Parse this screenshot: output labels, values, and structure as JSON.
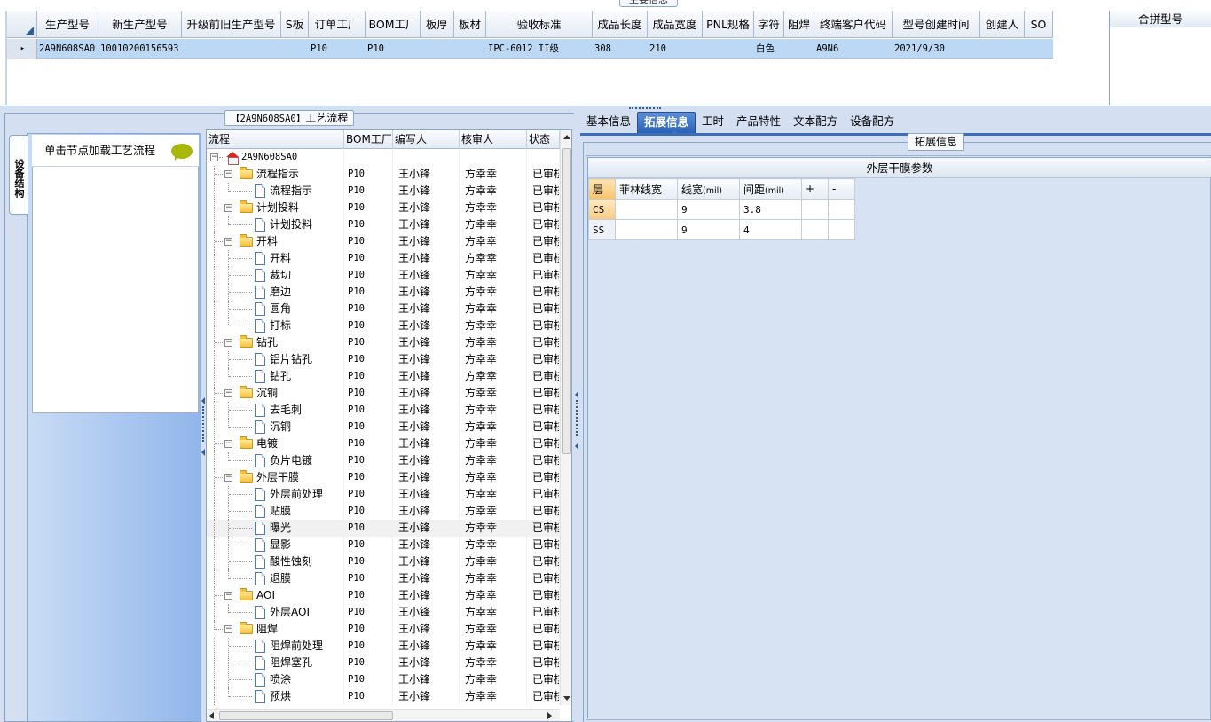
{
  "top_grid": {
    "tab_label": "主要信息",
    "columns": [
      "生产型号",
      "新生产型号",
      "升级前旧生产型号",
      "S板",
      "订单工厂",
      "BOM工厂",
      "板厚",
      "板材",
      "验收标准",
      "成品长度",
      "成品宽度",
      "PNL规格",
      "字符",
      "阻焊",
      "终端客户代码",
      "型号创建时间",
      "创建人",
      "SO"
    ],
    "row": {
      "indicator": "▸",
      "cells": [
        "2A9N608SA0",
        "10010200156593",
        "",
        "",
        "P10",
        "P10",
        "",
        "",
        "IPC-6012 II级",
        "308",
        "210",
        "",
        "白色",
        "",
        "A9N6",
        "2021/9/30",
        "",
        ""
      ]
    },
    "merge_header": "合拼型号"
  },
  "left": {
    "flow_title_code": "【2A9N608SA0】",
    "flow_title_label": "工艺流程",
    "vertical_tab": "设备结构",
    "side_hint": "单击节点加载工艺流程"
  },
  "tree": {
    "columns": [
      "流程",
      "BOM工厂",
      "编写人",
      "核审人",
      "状态"
    ],
    "rows": [
      {
        "name": "2A9N608SA0",
        "level": 0,
        "type": "root",
        "bom": "",
        "writer": "",
        "checker": "",
        "status": ""
      },
      {
        "name": "流程指示",
        "level": 1,
        "type": "folder",
        "bom": "P10",
        "writer": "王小锋",
        "checker": "方幸幸",
        "status": "已审核"
      },
      {
        "name": "流程指示",
        "level": 2,
        "type": "doc",
        "bom": "P10",
        "writer": "王小锋",
        "checker": "方幸幸",
        "status": "已审核"
      },
      {
        "name": "计划投料",
        "level": 1,
        "type": "folder",
        "bom": "P10",
        "writer": "王小锋",
        "checker": "方幸幸",
        "status": "已审核"
      },
      {
        "name": "计划投料",
        "level": 2,
        "type": "doc",
        "bom": "P10",
        "writer": "王小锋",
        "checker": "方幸幸",
        "status": "已审核"
      },
      {
        "name": "开料",
        "level": 1,
        "type": "folder",
        "bom": "P10",
        "writer": "王小锋",
        "checker": "方幸幸",
        "status": "已审核"
      },
      {
        "name": "开料",
        "level": 2,
        "type": "doc",
        "bom": "P10",
        "writer": "王小锋",
        "checker": "方幸幸",
        "status": "已审核"
      },
      {
        "name": "裁切",
        "level": 2,
        "type": "doc",
        "bom": "P10",
        "writer": "王小锋",
        "checker": "方幸幸",
        "status": "已审核"
      },
      {
        "name": "磨边",
        "level": 2,
        "type": "doc",
        "bom": "P10",
        "writer": "王小锋",
        "checker": "方幸幸",
        "status": "已审核"
      },
      {
        "name": "圆角",
        "level": 2,
        "type": "doc",
        "bom": "P10",
        "writer": "王小锋",
        "checker": "方幸幸",
        "status": "已审核"
      },
      {
        "name": "打标",
        "level": 2,
        "type": "doc",
        "bom": "P10",
        "writer": "王小锋",
        "checker": "方幸幸",
        "status": "已审核"
      },
      {
        "name": "钻孔",
        "level": 1,
        "type": "folder",
        "bom": "P10",
        "writer": "王小锋",
        "checker": "方幸幸",
        "status": "已审核"
      },
      {
        "name": "铝片钻孔",
        "level": 2,
        "type": "doc",
        "bom": "P10",
        "writer": "王小锋",
        "checker": "方幸幸",
        "status": "已审核"
      },
      {
        "name": "钻孔",
        "level": 2,
        "type": "doc",
        "bom": "P10",
        "writer": "王小锋",
        "checker": "方幸幸",
        "status": "已审核"
      },
      {
        "name": "沉铜",
        "level": 1,
        "type": "folder",
        "bom": "P10",
        "writer": "王小锋",
        "checker": "方幸幸",
        "status": "已审核"
      },
      {
        "name": "去毛刺",
        "level": 2,
        "type": "doc",
        "bom": "P10",
        "writer": "王小锋",
        "checker": "方幸幸",
        "status": "已审核"
      },
      {
        "name": "沉铜",
        "level": 2,
        "type": "doc",
        "bom": "P10",
        "writer": "王小锋",
        "checker": "方幸幸",
        "status": "已审核"
      },
      {
        "name": "电镀",
        "level": 1,
        "type": "folder",
        "bom": "P10",
        "writer": "王小锋",
        "checker": "方幸幸",
        "status": "已审核"
      },
      {
        "name": "负片电镀",
        "level": 2,
        "type": "doc",
        "bom": "P10",
        "writer": "王小锋",
        "checker": "方幸幸",
        "status": "已审核"
      },
      {
        "name": "外层干膜",
        "level": 1,
        "type": "folder",
        "bom": "P10",
        "writer": "王小锋",
        "checker": "方幸幸",
        "status": "已审核"
      },
      {
        "name": "外层前处理",
        "level": 2,
        "type": "doc",
        "bom": "P10",
        "writer": "王小锋",
        "checker": "方幸幸",
        "status": "已审核"
      },
      {
        "name": "贴膜",
        "level": 2,
        "type": "doc",
        "bom": "P10",
        "writer": "王小锋",
        "checker": "方幸幸",
        "status": "已审核"
      },
      {
        "name": "曝光",
        "level": 2,
        "type": "doc",
        "bom": "P10",
        "writer": "王小锋",
        "checker": "方幸幸",
        "status": "已审核",
        "selected": true
      },
      {
        "name": "显影",
        "level": 2,
        "type": "doc",
        "bom": "P10",
        "writer": "王小锋",
        "checker": "方幸幸",
        "status": "已审核"
      },
      {
        "name": "酸性蚀刻",
        "level": 2,
        "type": "doc",
        "bom": "P10",
        "writer": "王小锋",
        "checker": "方幸幸",
        "status": "已审核"
      },
      {
        "name": "退膜",
        "level": 2,
        "type": "doc",
        "bom": "P10",
        "writer": "王小锋",
        "checker": "方幸幸",
        "status": "已审核"
      },
      {
        "name": "AOI",
        "level": 1,
        "type": "folder",
        "bom": "P10",
        "writer": "王小锋",
        "checker": "方幸幸",
        "status": "已审核"
      },
      {
        "name": "外层AOI",
        "level": 2,
        "type": "doc",
        "bom": "P10",
        "writer": "王小锋",
        "checker": "方幸幸",
        "status": "已审核"
      },
      {
        "name": "阻焊",
        "level": 1,
        "type": "folder",
        "bom": "P10",
        "writer": "王小锋",
        "checker": "方幸幸",
        "status": "已审核"
      },
      {
        "name": "阻焊前处理",
        "level": 2,
        "type": "doc",
        "bom": "P10",
        "writer": "王小锋",
        "checker": "方幸幸",
        "status": "已审核"
      },
      {
        "name": "阻焊塞孔",
        "level": 2,
        "type": "doc",
        "bom": "P10",
        "writer": "王小锋",
        "checker": "方幸幸",
        "status": "已审核"
      },
      {
        "name": "喷涂",
        "level": 2,
        "type": "doc",
        "bom": "P10",
        "writer": "王小锋",
        "checker": "方幸幸",
        "status": "已审核"
      },
      {
        "name": "预烘",
        "level": 2,
        "type": "doc",
        "bom": "P10",
        "writer": "王小锋",
        "checker": "方幸幸",
        "status": "已审核"
      }
    ]
  },
  "right": {
    "tabs": [
      "基本信息",
      "拓展信息",
      "工时",
      "产品特性",
      "文本配方",
      "设备配方"
    ],
    "active_tab": 1,
    "group_title": "拓展信息",
    "grid_caption": "外层干膜参数",
    "param_columns": [
      "层",
      "菲林线宽",
      "线宽",
      "间距",
      "+",
      "-"
    ],
    "param_units": [
      "",
      "",
      "(mil)",
      "(mil)",
      "",
      ""
    ],
    "param_rows": [
      {
        "layer": "CS",
        "film_width": "",
        "line_width": "9",
        "spacing": "3.8"
      },
      {
        "layer": "SS",
        "film_width": "",
        "line_width": "9",
        "spacing": "4"
      }
    ]
  }
}
